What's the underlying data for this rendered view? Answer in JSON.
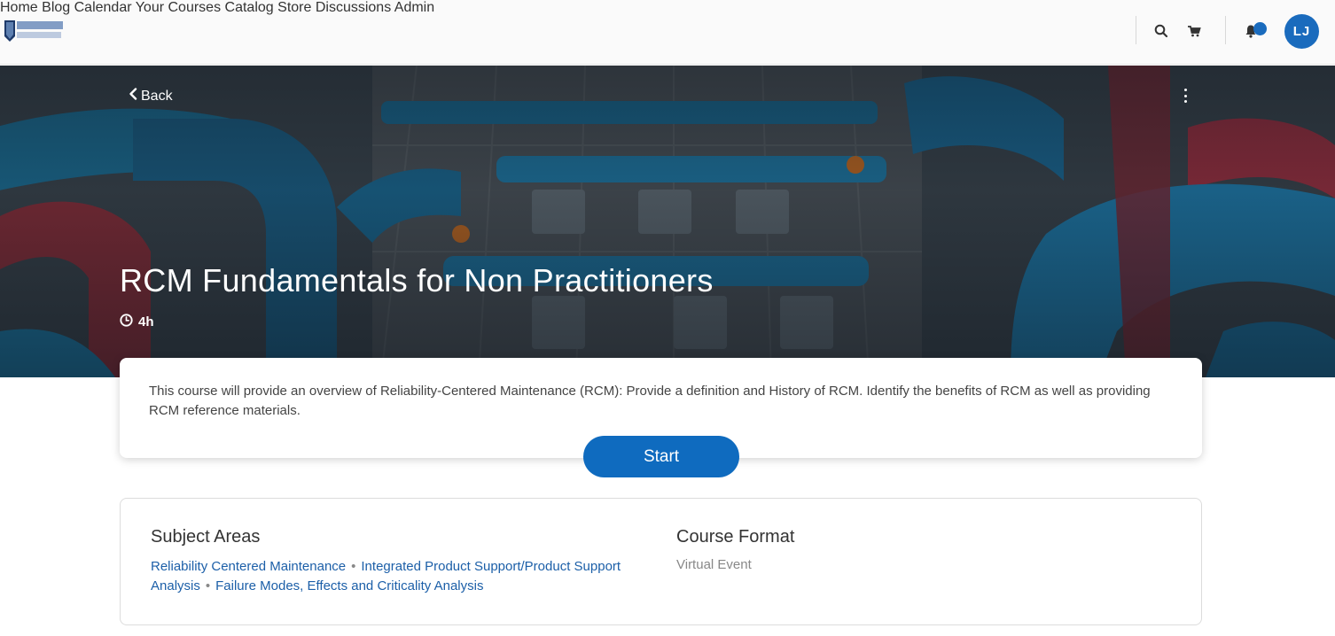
{
  "nav": {
    "items": [
      "Home",
      "Blog",
      "Calendar",
      "Your Courses",
      "Catalog",
      "Store",
      "Discussions",
      "Admin"
    ],
    "user_initials": "LJ"
  },
  "icons": {
    "search": "search-icon",
    "cart": "cart-icon",
    "bell": "bell-icon",
    "back": "chevron-left-icon",
    "clock": "clock-icon",
    "menu": "kebab-menu-icon"
  },
  "colors": {
    "accent": "#0f6bbf",
    "link": "#1c5fa8",
    "avatar": "#1a6bbd"
  },
  "hero": {
    "back_label": "Back",
    "title": "RCM Fundamentals for Non Practitioners",
    "duration": "4h"
  },
  "course": {
    "description": "This course will provide an overview of Reliability-Centered Maintenance (RCM): Provide a definition and History of RCM. Identify the benefits of RCM as well as providing RCM reference materials.",
    "start_label": "Start"
  },
  "details": {
    "subject_areas_heading": "Subject Areas",
    "subject_areas": [
      "Reliability Centered Maintenance",
      "Integrated Product Support/Product Support Analysis",
      "Failure Modes, Effects and Criticality Analysis"
    ],
    "course_format_heading": "Course Format",
    "course_format": "Virtual Event"
  }
}
